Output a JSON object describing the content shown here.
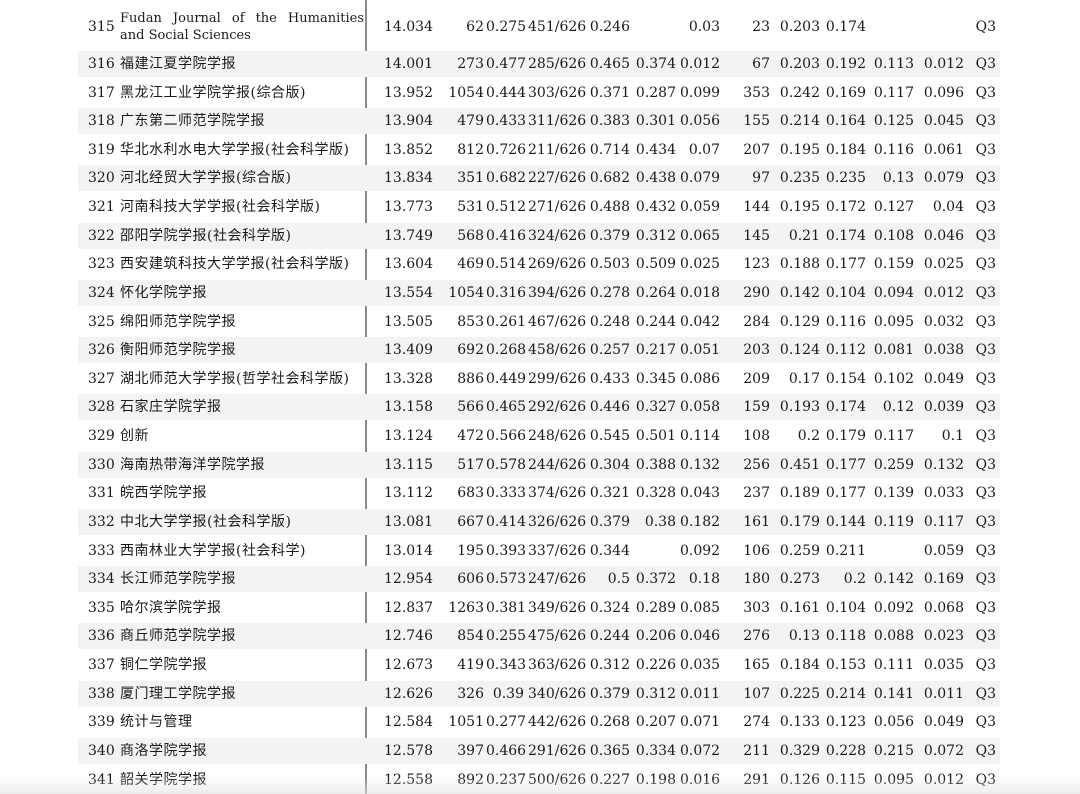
{
  "rows": [
    {
      "rank": "315",
      "journal": "Fudan Journal of the Humanities and Social Sciences",
      "v1": "14.034",
      "v2": "62",
      "v3": "0.275",
      "v4": "451/626",
      "v5": "0.246",
      "v6": "",
      "v7": "0.03",
      "v8": "23",
      "v9": "0.203",
      "v10": "0.174",
      "v11": "",
      "v12": "",
      "q": "Q3"
    },
    {
      "rank": "316",
      "journal": "福建江夏学院学报",
      "v1": "14.001",
      "v2": "273",
      "v3": "0.477",
      "v4": "285/626",
      "v5": "0.465",
      "v6": "0.374",
      "v7": "0.012",
      "v8": "67",
      "v9": "0.203",
      "v10": "0.192",
      "v11": "0.113",
      "v12": "0.012",
      "q": "Q3"
    },
    {
      "rank": "317",
      "journal": "黑龙江工业学院学报(综合版)",
      "v1": "13.952",
      "v2": "1054",
      "v3": "0.444",
      "v4": "303/626",
      "v5": "0.371",
      "v6": "0.287",
      "v7": "0.099",
      "v8": "353",
      "v9": "0.242",
      "v10": "0.169",
      "v11": "0.117",
      "v12": "0.096",
      "q": "Q3"
    },
    {
      "rank": "318",
      "journal": "广东第二师范学院学报",
      "v1": "13.904",
      "v2": "479",
      "v3": "0.433",
      "v4": "311/626",
      "v5": "0.383",
      "v6": "0.301",
      "v7": "0.056",
      "v8": "155",
      "v9": "0.214",
      "v10": "0.164",
      "v11": "0.125",
      "v12": "0.045",
      "q": "Q3"
    },
    {
      "rank": "319",
      "journal": "华北水利水电大学学报(社会科学版)",
      "v1": "13.852",
      "v2": "812",
      "v3": "0.726",
      "v4": "211/626",
      "v5": "0.714",
      "v6": "0.434",
      "v7": "0.07",
      "v8": "207",
      "v9": "0.195",
      "v10": "0.184",
      "v11": "0.116",
      "v12": "0.061",
      "q": "Q3"
    },
    {
      "rank": "320",
      "journal": "河北经贸大学学报(综合版)",
      "v1": "13.834",
      "v2": "351",
      "v3": "0.682",
      "v4": "227/626",
      "v5": "0.682",
      "v6": "0.438",
      "v7": "0.079",
      "v8": "97",
      "v9": "0.235",
      "v10": "0.235",
      "v11": "0.13",
      "v12": "0.079",
      "q": "Q3"
    },
    {
      "rank": "321",
      "journal": "河南科技大学学报(社会科学版)",
      "v1": "13.773",
      "v2": "531",
      "v3": "0.512",
      "v4": "271/626",
      "v5": "0.488",
      "v6": "0.432",
      "v7": "0.059",
      "v8": "144",
      "v9": "0.195",
      "v10": "0.172",
      "v11": "0.127",
      "v12": "0.04",
      "q": "Q3"
    },
    {
      "rank": "322",
      "journal": "邵阳学院学报(社会科学版)",
      "v1": "13.749",
      "v2": "568",
      "v3": "0.416",
      "v4": "324/626",
      "v5": "0.379",
      "v6": "0.312",
      "v7": "0.065",
      "v8": "145",
      "v9": "0.21",
      "v10": "0.174",
      "v11": "0.108",
      "v12": "0.046",
      "q": "Q3"
    },
    {
      "rank": "323",
      "journal": "西安建筑科技大学学报(社会科学版)",
      "v1": "13.604",
      "v2": "469",
      "v3": "0.514",
      "v4": "269/626",
      "v5": "0.503",
      "v6": "0.509",
      "v7": "0.025",
      "v8": "123",
      "v9": "0.188",
      "v10": "0.177",
      "v11": "0.159",
      "v12": "0.025",
      "q": "Q3"
    },
    {
      "rank": "324",
      "journal": "怀化学院学报",
      "v1": "13.554",
      "v2": "1054",
      "v3": "0.316",
      "v4": "394/626",
      "v5": "0.278",
      "v6": "0.264",
      "v7": "0.018",
      "v8": "290",
      "v9": "0.142",
      "v10": "0.104",
      "v11": "0.094",
      "v12": "0.012",
      "q": "Q3"
    },
    {
      "rank": "325",
      "journal": "绵阳师范学院学报",
      "v1": "13.505",
      "v2": "853",
      "v3": "0.261",
      "v4": "467/626",
      "v5": "0.248",
      "v6": "0.244",
      "v7": "0.042",
      "v8": "284",
      "v9": "0.129",
      "v10": "0.116",
      "v11": "0.095",
      "v12": "0.032",
      "q": "Q3"
    },
    {
      "rank": "326",
      "journal": "衡阳师范学院学报",
      "v1": "13.409",
      "v2": "692",
      "v3": "0.268",
      "v4": "458/626",
      "v5": "0.257",
      "v6": "0.217",
      "v7": "0.051",
      "v8": "203",
      "v9": "0.124",
      "v10": "0.112",
      "v11": "0.081",
      "v12": "0.038",
      "q": "Q3"
    },
    {
      "rank": "327",
      "journal": "湖北师范大学学报(哲学社会科学版)",
      "v1": "13.328",
      "v2": "886",
      "v3": "0.449",
      "v4": "299/626",
      "v5": "0.433",
      "v6": "0.345",
      "v7": "0.086",
      "v8": "209",
      "v9": "0.17",
      "v10": "0.154",
      "v11": "0.102",
      "v12": "0.049",
      "q": "Q3"
    },
    {
      "rank": "328",
      "journal": "石家庄学院学报",
      "v1": "13.158",
      "v2": "566",
      "v3": "0.465",
      "v4": "292/626",
      "v5": "0.446",
      "v6": "0.327",
      "v7": "0.058",
      "v8": "159",
      "v9": "0.193",
      "v10": "0.174",
      "v11": "0.12",
      "v12": "0.039",
      "q": "Q3"
    },
    {
      "rank": "329",
      "journal": "创新",
      "v1": "13.124",
      "v2": "472",
      "v3": "0.566",
      "v4": "248/626",
      "v5": "0.545",
      "v6": "0.501",
      "v7": "0.114",
      "v8": "108",
      "v9": "0.2",
      "v10": "0.179",
      "v11": "0.117",
      "v12": "0.1",
      "q": "Q3"
    },
    {
      "rank": "330",
      "journal": "海南热带海洋学院学报",
      "v1": "13.115",
      "v2": "517",
      "v3": "0.578",
      "v4": "244/626",
      "v5": "0.304",
      "v6": "0.388",
      "v7": "0.132",
      "v8": "256",
      "v9": "0.451",
      "v10": "0.177",
      "v11": "0.259",
      "v12": "0.132",
      "q": "Q3"
    },
    {
      "rank": "331",
      "journal": "皖西学院学报",
      "v1": "13.112",
      "v2": "683",
      "v3": "0.333",
      "v4": "374/626",
      "v5": "0.321",
      "v6": "0.328",
      "v7": "0.043",
      "v8": "237",
      "v9": "0.189",
      "v10": "0.177",
      "v11": "0.139",
      "v12": "0.033",
      "q": "Q3"
    },
    {
      "rank": "332",
      "journal": "中北大学学报(社会科学版)",
      "v1": "13.081",
      "v2": "667",
      "v3": "0.414",
      "v4": "326/626",
      "v5": "0.379",
      "v6": "0.38",
      "v7": "0.182",
      "v8": "161",
      "v9": "0.179",
      "v10": "0.144",
      "v11": "0.119",
      "v12": "0.117",
      "q": "Q3"
    },
    {
      "rank": "333",
      "journal": "西南林业大学学报(社会科学)",
      "v1": "13.014",
      "v2": "195",
      "v3": "0.393",
      "v4": "337/626",
      "v5": "0.344",
      "v6": "",
      "v7": "0.092",
      "v8": "106",
      "v9": "0.259",
      "v10": "0.211",
      "v11": "",
      "v12": "0.059",
      "q": "Q3"
    },
    {
      "rank": "334",
      "journal": "长江师范学院学报",
      "v1": "12.954",
      "v2": "606",
      "v3": "0.573",
      "v4": "247/626",
      "v5": "0.5",
      "v6": "0.372",
      "v7": "0.18",
      "v8": "180",
      "v9": "0.273",
      "v10": "0.2",
      "v11": "0.142",
      "v12": "0.169",
      "q": "Q3"
    },
    {
      "rank": "335",
      "journal": "哈尔滨学院学报",
      "v1": "12.837",
      "v2": "1263",
      "v3": "0.381",
      "v4": "349/626",
      "v5": "0.324",
      "v6": "0.289",
      "v7": "0.085",
      "v8": "303",
      "v9": "0.161",
      "v10": "0.104",
      "v11": "0.092",
      "v12": "0.068",
      "q": "Q3"
    },
    {
      "rank": "336",
      "journal": "商丘师范学院学报",
      "v1": "12.746",
      "v2": "854",
      "v3": "0.255",
      "v4": "475/626",
      "v5": "0.244",
      "v6": "0.206",
      "v7": "0.046",
      "v8": "276",
      "v9": "0.13",
      "v10": "0.118",
      "v11": "0.088",
      "v12": "0.023",
      "q": "Q3"
    },
    {
      "rank": "337",
      "journal": "铜仁学院学报",
      "v1": "12.673",
      "v2": "419",
      "v3": "0.343",
      "v4": "363/626",
      "v5": "0.312",
      "v6": "0.226",
      "v7": "0.035",
      "v8": "165",
      "v9": "0.184",
      "v10": "0.153",
      "v11": "0.111",
      "v12": "0.035",
      "q": "Q3"
    },
    {
      "rank": "338",
      "journal": "厦门理工学院学报",
      "v1": "12.626",
      "v2": "326",
      "v3": "0.39",
      "v4": "340/626",
      "v5": "0.379",
      "v6": "0.312",
      "v7": "0.011",
      "v8": "107",
      "v9": "0.225",
      "v10": "0.214",
      "v11": "0.141",
      "v12": "0.011",
      "q": "Q3"
    },
    {
      "rank": "339",
      "journal": "统计与管理",
      "v1": "12.584",
      "v2": "1051",
      "v3": "0.277",
      "v4": "442/626",
      "v5": "0.268",
      "v6": "0.207",
      "v7": "0.071",
      "v8": "274",
      "v9": "0.133",
      "v10": "0.123",
      "v11": "0.056",
      "v12": "0.049",
      "q": "Q3"
    },
    {
      "rank": "340",
      "journal": "商洛学院学报",
      "v1": "12.578",
      "v2": "397",
      "v3": "0.466",
      "v4": "291/626",
      "v5": "0.365",
      "v6": "0.334",
      "v7": "0.072",
      "v8": "211",
      "v9": "0.329",
      "v10": "0.228",
      "v11": "0.215",
      "v12": "0.072",
      "q": "Q3"
    },
    {
      "rank": "341",
      "journal": "韶关学院学报",
      "v1": "12.558",
      "v2": "892",
      "v3": "0.237",
      "v4": "500/626",
      "v5": "0.227",
      "v6": "0.198",
      "v7": "0.016",
      "v8": "291",
      "v9": "0.126",
      "v10": "0.115",
      "v11": "0.095",
      "v12": "0.012",
      "q": "Q3"
    }
  ]
}
